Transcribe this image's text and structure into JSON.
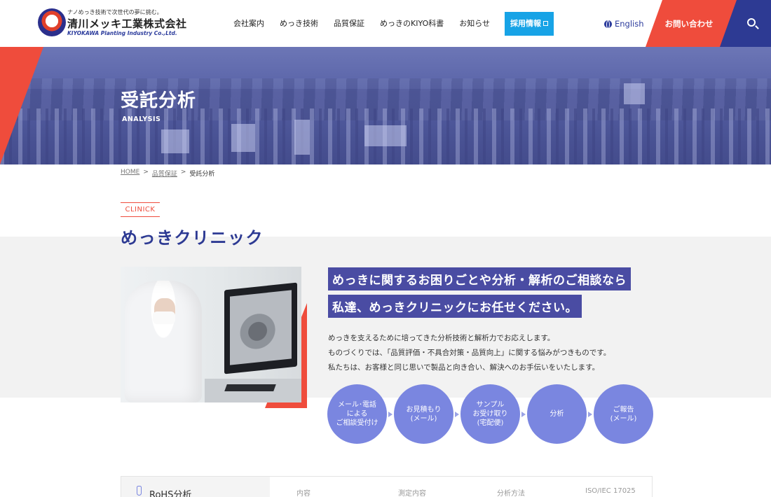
{
  "header": {
    "logo": {
      "tagline": "ナノめっき技術で次世代の夢に挑む。",
      "name": "清川メッキ工業株式会社",
      "name_en": "KIYOKAWA Planting Industry Co.,Ltd."
    },
    "nav": [
      {
        "label": "会社案内"
      },
      {
        "label": "めっき技術"
      },
      {
        "label": "品質保証"
      },
      {
        "label": "めっきのKIYO科書"
      },
      {
        "label": "お知らせ"
      }
    ],
    "recruit_label": "採用情報",
    "lang_label": "English",
    "contact_label": "お問い合わせ",
    "colors": {
      "accent_red": "#ef4c3c",
      "brand_navy": "#2d3a93",
      "recruit_blue": "#17a3e6"
    }
  },
  "hero": {
    "title": "受託分析",
    "subtitle": "ANALYSIS"
  },
  "breadcrumb": {
    "home": "HOME",
    "sep1": ">",
    "parent": "品質保証",
    "sep2": ">",
    "current": "受託分析"
  },
  "clinic": {
    "eyebrow": "CLINICK",
    "title": "めっきクリニック",
    "headline_1": "めっきに関するお困りごとや分析・解析のご相談なら",
    "headline_2": "私達、めっきクリニックにお任せください。",
    "body": [
      "めっきを支えるために培ってきた分析技術と解析力でお応えします。",
      "ものづくりでは、「品質評価・不具合対策・品質向上」に関する悩みがつきものです。",
      "私たちは、お客様と同じ思いで製品と向き合い、解決へのお手伝いをいたします。"
    ],
    "flow": [
      {
        "label": "メール･電話\nによる\nご相談受付け"
      },
      {
        "label": "お見積もり\n(メール)"
      },
      {
        "label": "サンプル\nお受け取り\n(宅配便)"
      },
      {
        "label": "分析"
      },
      {
        "label": "ご報告\n(メール)"
      }
    ]
  },
  "table": {
    "section_label": "RoHS分析",
    "columns": [
      "内容",
      "測定内容",
      "分析方法",
      "ISO/IEC 17025"
    ]
  }
}
